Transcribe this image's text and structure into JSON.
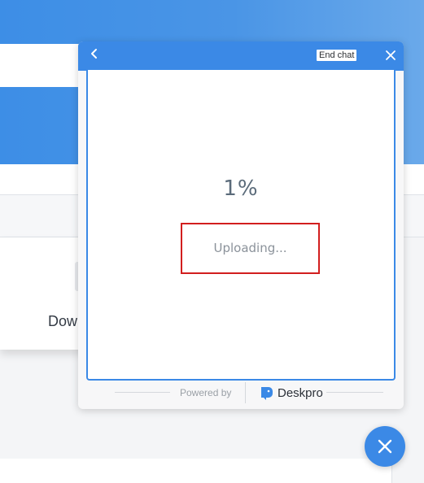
{
  "background": {
    "card_text": "Dow"
  },
  "chat": {
    "back_icon": "chevron-left-icon",
    "end_chat_label": "End chat",
    "close_icon": "close-icon",
    "progress": {
      "percent": 1,
      "percent_text": "1%"
    },
    "upload_status": "Uploading...",
    "footer": {
      "powered_by": "Powered by",
      "brand_name": "Deskpro",
      "brand_icon": "deskpro-elephant-icon"
    }
  },
  "fab": {
    "icon": "close-icon"
  },
  "colors": {
    "accent": "#3b89e6",
    "highlight_box": "#d21e1e",
    "text_muted": "#8b929a"
  }
}
